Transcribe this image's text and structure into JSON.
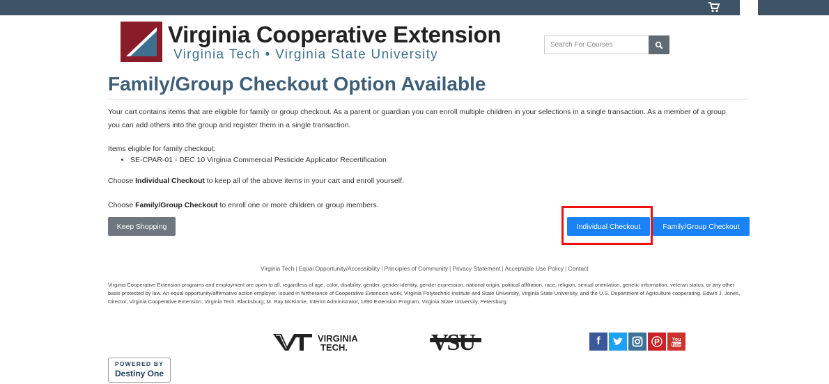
{
  "header": {
    "logo_title": "Virginia Cooperative Extension",
    "logo_subtitle": "Virginia Tech  •  Virginia State University",
    "search_placeholder": "Search For Courses"
  },
  "main": {
    "title": "Family/Group Checkout Option Available",
    "intro": "Your cart contains items that are eligible for family or group checkout. As a parent or guardian you can enroll multiple children in your selections in a single transaction. As a member of a group you can add others into the group and register them in a single transaction.",
    "eligible_label": "Items eligible for family checkout:",
    "eligible_items": [
      "SE-CPAR-01 - DEC 10 Virginia Commercial Pesticide Applicator Recertification"
    ],
    "choose_individual_prefix": "Choose ",
    "choose_individual_bold": "Individual Checkout",
    "choose_individual_suffix": " to keep all of the above items in your cart and enroll yourself.",
    "choose_family_prefix": "Choose ",
    "choose_family_bold": "Family/Group Checkout",
    "choose_family_suffix": " to enroll one or more children or group members."
  },
  "buttons": {
    "keep_shopping": "Keep Shopping",
    "individual_checkout": "Individual Checkout",
    "family_checkout": "Family/Group Checkout"
  },
  "footer": {
    "links": [
      "Virginia Tech",
      "Equal Opportunity/Accessibility",
      "Principles of Community",
      "Privacy Statement",
      "Acceptable Use Policy",
      "Contact"
    ],
    "separator": "|",
    "disclaimer": "Virginia Cooperative Extension programs and employment are open to all, regardless of age, color, disability, gender, gender identity, gender expression, national origin, political affiliation, race, religion, sexual orientation, genetic information, veteran status, or any other basis protected by law. An equal opportunity/affirmative action employer. Issued in furtherance of Cooperative Extension work, Virginia Polytechnic Institute and State University, Virginia State University, and the U.S. Department of Agriculture cooperating. Edwin J. Jones, Director, Virginia Cooperative Extension, Virginia Tech, Blacksburg; M. Ray McKinnie, Interim Administrator, 1890 Extension Program, Virginia State University, Petersburg.",
    "vt_logo_text": "VIRGINIA TECH.",
    "vsu_logo_text": "VSU",
    "social": [
      {
        "icon": "facebook-icon",
        "glyph": "f",
        "color": "#3b5998"
      },
      {
        "icon": "twitter-icon",
        "glyph": "t",
        "color": "#1da1f2"
      },
      {
        "icon": "instagram-icon",
        "glyph": "◎",
        "color": "#3f729b"
      },
      {
        "icon": "pinterest-icon",
        "glyph": "P",
        "color": "#cb2027"
      },
      {
        "icon": "youtube-icon",
        "glyph": "▶",
        "color": "#cd332d"
      }
    ],
    "powered_by": "POWERED BY",
    "powered_name": "Destiny One"
  },
  "colors": {
    "topbar": "#3e5466",
    "primary_button": "#1a82f5",
    "secondary_button": "#6e777f",
    "highlight": "#ee1111",
    "title": "#3e5e78"
  }
}
